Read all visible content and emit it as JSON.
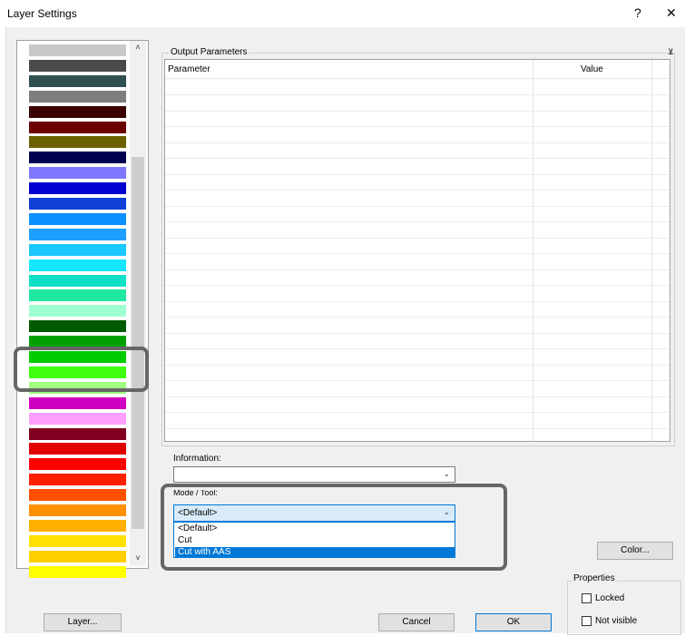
{
  "window": {
    "title": "Layer Settings",
    "help": "?",
    "close": "✕"
  },
  "color_list": {
    "colors": [
      "#c8c8c8",
      "#4a4a4a",
      "#2f5050",
      "#7e7e7e",
      "#3c0000",
      "#6a0000",
      "#6b6000",
      "#000050",
      "#7f78ff",
      "#0000d0",
      "#1040d8",
      "#0a90ff",
      "#1f9fff",
      "#18c8ff",
      "#16e6ff",
      "#10e0c8",
      "#20e8a0",
      "#a0ffd0",
      "#005a00",
      "#00a000",
      "#00cc00",
      "#40ff10",
      "#a0ff80",
      "#d000c0",
      "#ffa0ff",
      "#800020",
      "#e00000",
      "#ff0000",
      "#ff2000",
      "#ff5000",
      "#ff9000",
      "#ffb000",
      "#ffe000",
      "#ffd000",
      "#ffff00"
    ],
    "scroll_up": "˄",
    "scroll_down": "˅"
  },
  "output_parameters": {
    "title": "Output Parameters",
    "collapse_icon": "⊻",
    "columns": [
      "Parameter",
      "Value"
    ]
  },
  "information": {
    "label": "Information:",
    "value": ""
  },
  "mode_tool": {
    "label": "Mode / Tool:",
    "selected": "<Default>",
    "options": [
      "<Default>",
      "Cut",
      "Cut with AAS"
    ],
    "highlighted_index": 2
  },
  "buttons": {
    "color": "Color...",
    "layer": "Layer...",
    "cancel": "Cancel",
    "ok": "OK"
  },
  "properties": {
    "title": "Properties",
    "locked": "Locked",
    "not_visible": "Not visible"
  }
}
